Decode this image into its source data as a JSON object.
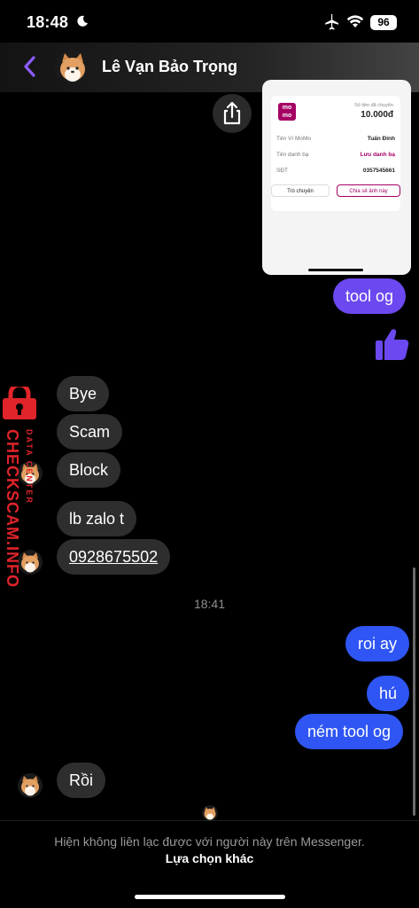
{
  "status_bar": {
    "time": "18:48",
    "battery": "96"
  },
  "header": {
    "contact_name": "Lê Vạn Bảo Trọng"
  },
  "shared_image": {
    "brand": "mo mo",
    "amount_label": "Số tiền đã chuyển",
    "amount": "10.000đ",
    "rows": [
      {
        "key": "Tên Ví MoMo",
        "value": "Tuấn Đinh"
      },
      {
        "key": "Tên danh bạ",
        "value": "Lưu danh bạ"
      },
      {
        "key": "SĐT",
        "value": "0357545661"
      }
    ],
    "button_chat": "Trò chuyện",
    "button_share": "Chia sẻ ảnh này"
  },
  "messages": [
    {
      "dir": "out",
      "text": "tool og"
    },
    {
      "dir": "in",
      "text": "Bye"
    },
    {
      "dir": "in",
      "text": "Scam"
    },
    {
      "dir": "in",
      "text": "Block"
    },
    {
      "dir": "in",
      "text": "lb zalo t"
    },
    {
      "dir": "in",
      "text": "0928675502"
    },
    {
      "dir": "out",
      "text": "roi ay"
    },
    {
      "dir": "out",
      "text": "hú"
    },
    {
      "dir": "out",
      "text": "ném tool og"
    },
    {
      "dir": "in",
      "text": "Rồi"
    }
  ],
  "timestamp": "18:41",
  "watermark": {
    "brand": "CHECKSCAM.INFO",
    "sub": "DATA CENTER"
  },
  "footer": {
    "info": "Hiện không liên lạc được với người này trên Messenger.",
    "action": "Lựa chọn khác"
  },
  "colors": {
    "outgoing": "#2f56f4",
    "outgoing_purple": "#6b48f0",
    "incoming": "#2e2e2e",
    "accent": "#7b4dff",
    "watermark": "#e0242a"
  }
}
